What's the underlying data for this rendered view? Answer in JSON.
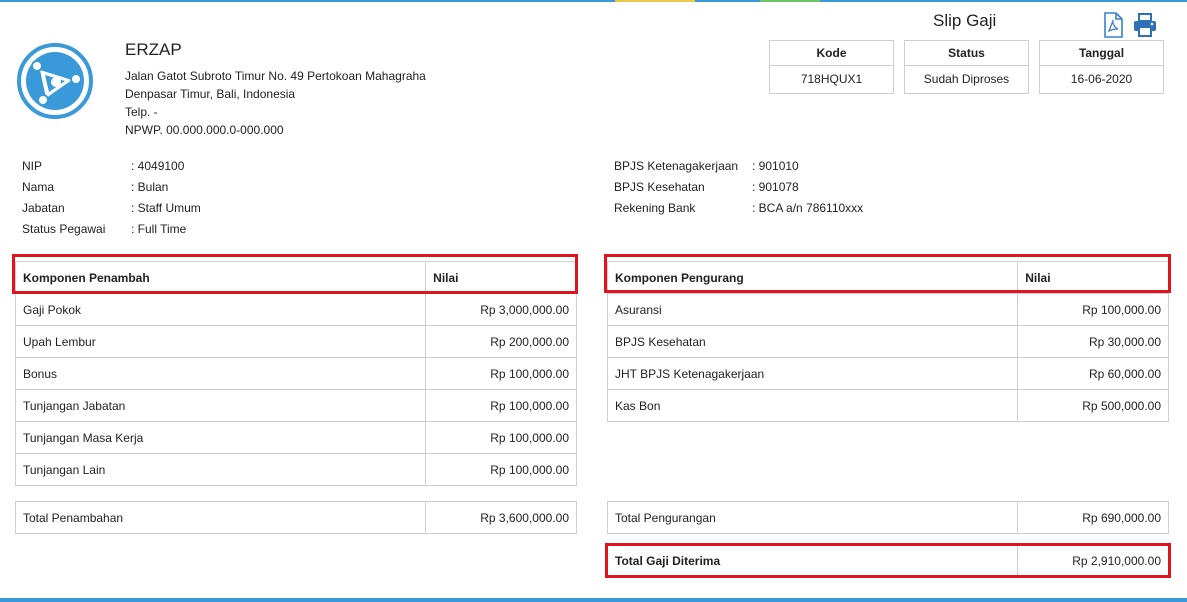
{
  "company": {
    "name": "ERZAP",
    "address1": "Jalan Gatot Subroto Timur No. 49 Pertokoan Mahagraha",
    "address2": "Denpasar Timur, Bali, Indonesia",
    "phone": "Telp. -",
    "npwp": "NPWP. 00.000.000.0-000.000"
  },
  "slip": {
    "title": "Slip Gaji",
    "kode_label": "Kode",
    "kode_value": "718HQUX1",
    "status_label": "Status",
    "status_value": "Sudah Diproses",
    "tanggal_label": "Tanggal",
    "tanggal_value": "16-06-2020"
  },
  "icons": {
    "pdf": "pdf-icon",
    "print": "printer-icon",
    "logo": "company-logo"
  },
  "employee_left": [
    {
      "label": "NIP",
      "value": ": 4049100"
    },
    {
      "label": "Nama",
      "value": ": Bulan"
    },
    {
      "label": "Jabatan",
      "value": ": Staff Umum"
    },
    {
      "label": "Status Pegawai",
      "value": ": Full Time"
    }
  ],
  "employee_right": [
    {
      "label": "BPJS Ketenagakerjaan",
      "value": ": 901010"
    },
    {
      "label": "BPJS Kesehatan",
      "value": ": 901078"
    },
    {
      "label": "Rekening Bank",
      "value": ": BCA a/n 786110xxx"
    }
  ],
  "penambah": {
    "header_component": "Komponen Penambah",
    "header_value": "Nilai",
    "rows": [
      {
        "name": "Gaji Pokok",
        "value": "Rp 3,000,000.00"
      },
      {
        "name": "Upah Lembur",
        "value": "Rp 200,000.00"
      },
      {
        "name": "Bonus",
        "value": "Rp 100,000.00"
      },
      {
        "name": "Tunjangan Jabatan",
        "value": "Rp 100,000.00"
      },
      {
        "name": "Tunjangan Masa Kerja",
        "value": "Rp 100,000.00"
      },
      {
        "name": "Tunjangan Lain",
        "value": "Rp 100,000.00"
      }
    ],
    "total_label": "Total Penambahan",
    "total_value": "Rp 3,600,000.00"
  },
  "pengurang": {
    "header_component": "Komponen Pengurang",
    "header_value": "Nilai",
    "rows": [
      {
        "name": "Asuransi",
        "value": "Rp 100,000.00"
      },
      {
        "name": "BPJS Kesehatan",
        "value": "Rp 30,000.00"
      },
      {
        "name": "JHT BPJS Ketenagakerjaan",
        "value": "Rp 60,000.00"
      },
      {
        "name": "Kas Bon",
        "value": "Rp 500,000.00"
      }
    ],
    "total_label": "Total Pengurangan",
    "total_value": "Rp 690,000.00"
  },
  "net": {
    "label": "Total Gaji Diterima",
    "value": "Rp 2,910,000.00"
  },
  "colors": {
    "accent": "#3a9ad9",
    "highlight": "#e0141e",
    "pdf_icon": "#3a7fd0",
    "print_icon": "#2f6fb8"
  }
}
